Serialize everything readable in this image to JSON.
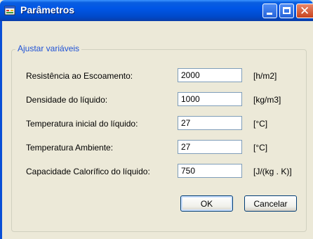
{
  "window": {
    "title": "Parâmetros"
  },
  "group": {
    "legend": "Ajustar variáveis"
  },
  "fields": [
    {
      "label": "Resistência ao Escoamento:",
      "value": "2000",
      "unit": "[h/m2]"
    },
    {
      "label": "Densidade do líquido:",
      "value": "1000",
      "unit": "[kg/m3]"
    },
    {
      "label": "Temperatura inicial do líquido:",
      "value": "27",
      "unit": "[°C]"
    },
    {
      "label": "Temperatura Ambiente:",
      "value": "27",
      "unit": "[°C]"
    },
    {
      "label": "Capacidade Calorífico do líquido:",
      "value": "750",
      "unit": "[J/(kg . K)]"
    }
  ],
  "buttons": {
    "ok": "OK",
    "cancel": "Cancelar"
  },
  "colors": {
    "titlebar": "#0054e3",
    "group_legend": "#1f52d6",
    "window_bg": "#ece9d8"
  },
  "icons": {
    "app": "window-app-icon",
    "minimize": "minimize-icon",
    "maximize": "maximize-icon",
    "close": "close-icon"
  }
}
